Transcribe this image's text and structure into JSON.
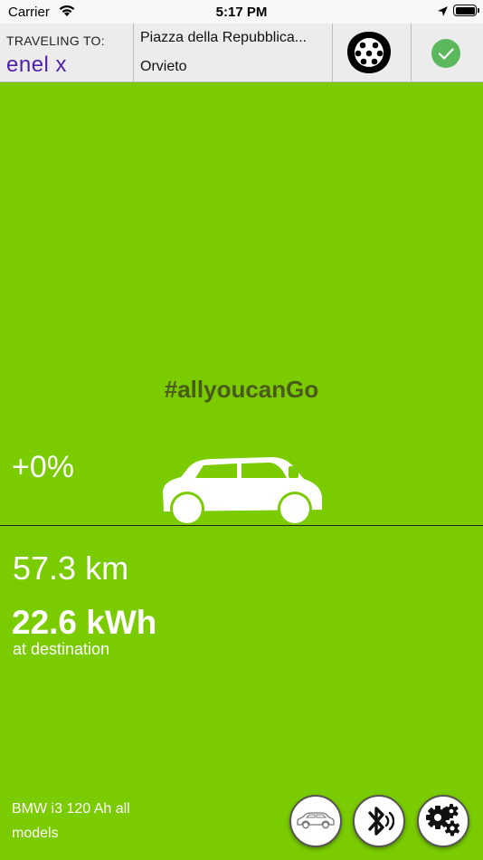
{
  "status_bar": {
    "carrier": "Carrier",
    "time": "5:17 PM"
  },
  "header": {
    "traveling_label": "TRAVELING TO:",
    "brand": "enel x",
    "destination_line1": "Piazza della Repubblica...",
    "destination_line2": "Orvieto",
    "connector_icon": "charging-connector-icon",
    "confirm_icon": "check-icon"
  },
  "main": {
    "hashtag": "#allyoucanGo",
    "charge_percent": "+0%",
    "distance": "57.3 km",
    "energy": "22.6 kWh",
    "energy_label": "at destination",
    "vehicle": "BMW i3 120 Ah all models"
  },
  "toolbar": {
    "buttons": [
      {
        "icon": "car-icon"
      },
      {
        "icon": "bluetooth-icon"
      },
      {
        "icon": "gears-icon"
      }
    ]
  },
  "colors": {
    "background": "#7acb00",
    "brand": "#4f1fa8",
    "hashtag": "#4a5a1a",
    "confirm": "#5cb85c"
  }
}
